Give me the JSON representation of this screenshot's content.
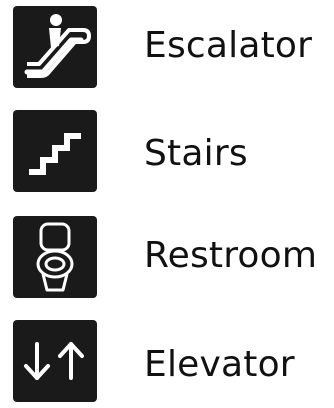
{
  "items": [
    {
      "label": "Escalator",
      "icon": "escalator-icon"
    },
    {
      "label": "Stairs",
      "icon": "stairs-icon"
    },
    {
      "label": "Restroom",
      "icon": "toilet-icon"
    },
    {
      "label": "Elevator",
      "icon": "elevator-icon"
    }
  ],
  "colors": {
    "icon_background": "#1a1a1a",
    "icon_foreground": "#ffffff",
    "text": "#111111",
    "page_background": "#ffffff"
  }
}
